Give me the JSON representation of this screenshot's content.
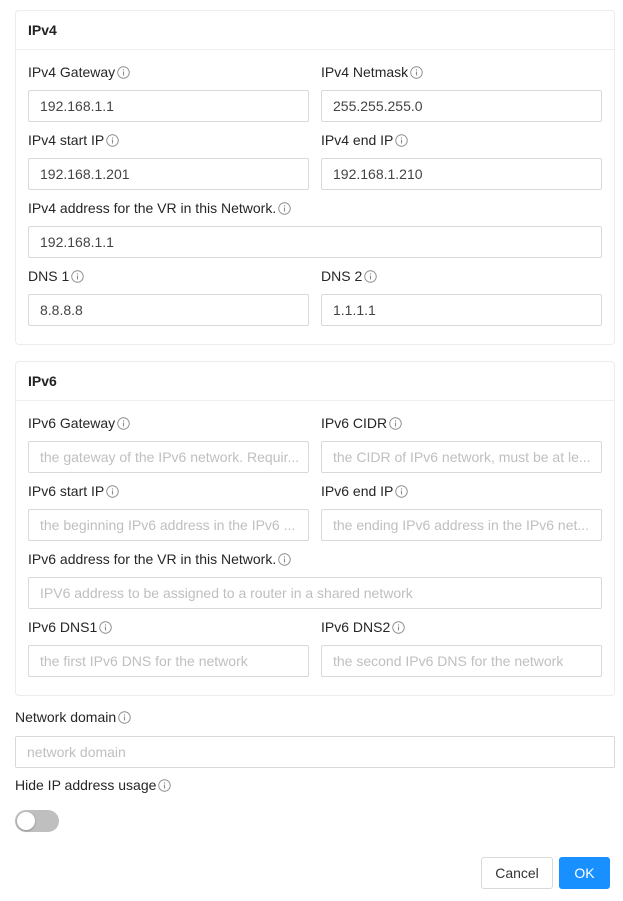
{
  "ipv4": {
    "title": "IPv4",
    "gateway": {
      "label": "IPv4 Gateway",
      "value": "192.168.1.1"
    },
    "netmask": {
      "label": "IPv4 Netmask",
      "value": "255.255.255.0"
    },
    "start_ip": {
      "label": "IPv4 start IP",
      "value": "192.168.1.201"
    },
    "end_ip": {
      "label": "IPv4 end IP",
      "value": "192.168.1.210"
    },
    "vr_address": {
      "label": "IPv4 address for the VR in this Network.",
      "value": "192.168.1.1"
    },
    "dns1": {
      "label": "DNS 1",
      "value": "8.8.8.8"
    },
    "dns2": {
      "label": "DNS 2",
      "value": "1.1.1.1"
    }
  },
  "ipv6": {
    "title": "IPv6",
    "gateway": {
      "label": "IPv6 Gateway",
      "placeholder": "the gateway of the IPv6 network. Requir..."
    },
    "cidr": {
      "label": "IPv6 CIDR",
      "placeholder": "the CIDR of IPv6 network, must be at le..."
    },
    "start_ip": {
      "label": "IPv6 start IP",
      "placeholder": "the beginning IPv6 address in the IPv6 ..."
    },
    "end_ip": {
      "label": "IPv6 end IP",
      "placeholder": "the ending IPv6 address in the IPv6 net..."
    },
    "vr_address": {
      "label": "IPv6 address for the VR in this Network.",
      "placeholder": "IPV6 address to be assigned to a router in a shared network"
    },
    "dns1": {
      "label": "IPv6 DNS1",
      "placeholder": "the first IPv6 DNS for the network"
    },
    "dns2": {
      "label": "IPv6 DNS2",
      "placeholder": "the second IPv6 DNS for the network"
    }
  },
  "network_domain": {
    "label": "Network domain",
    "placeholder": "network domain"
  },
  "hide_ip_usage": {
    "label": "Hide IP address usage",
    "enabled": false
  },
  "buttons": {
    "cancel": "Cancel",
    "ok": "OK"
  },
  "colors": {
    "primary": "#1890ff",
    "border": "#d9d9d9",
    "placeholder": "#bfbfbf",
    "toggle_off": "#bfbfbf"
  },
  "icons": {
    "info": "info-circle-icon"
  }
}
